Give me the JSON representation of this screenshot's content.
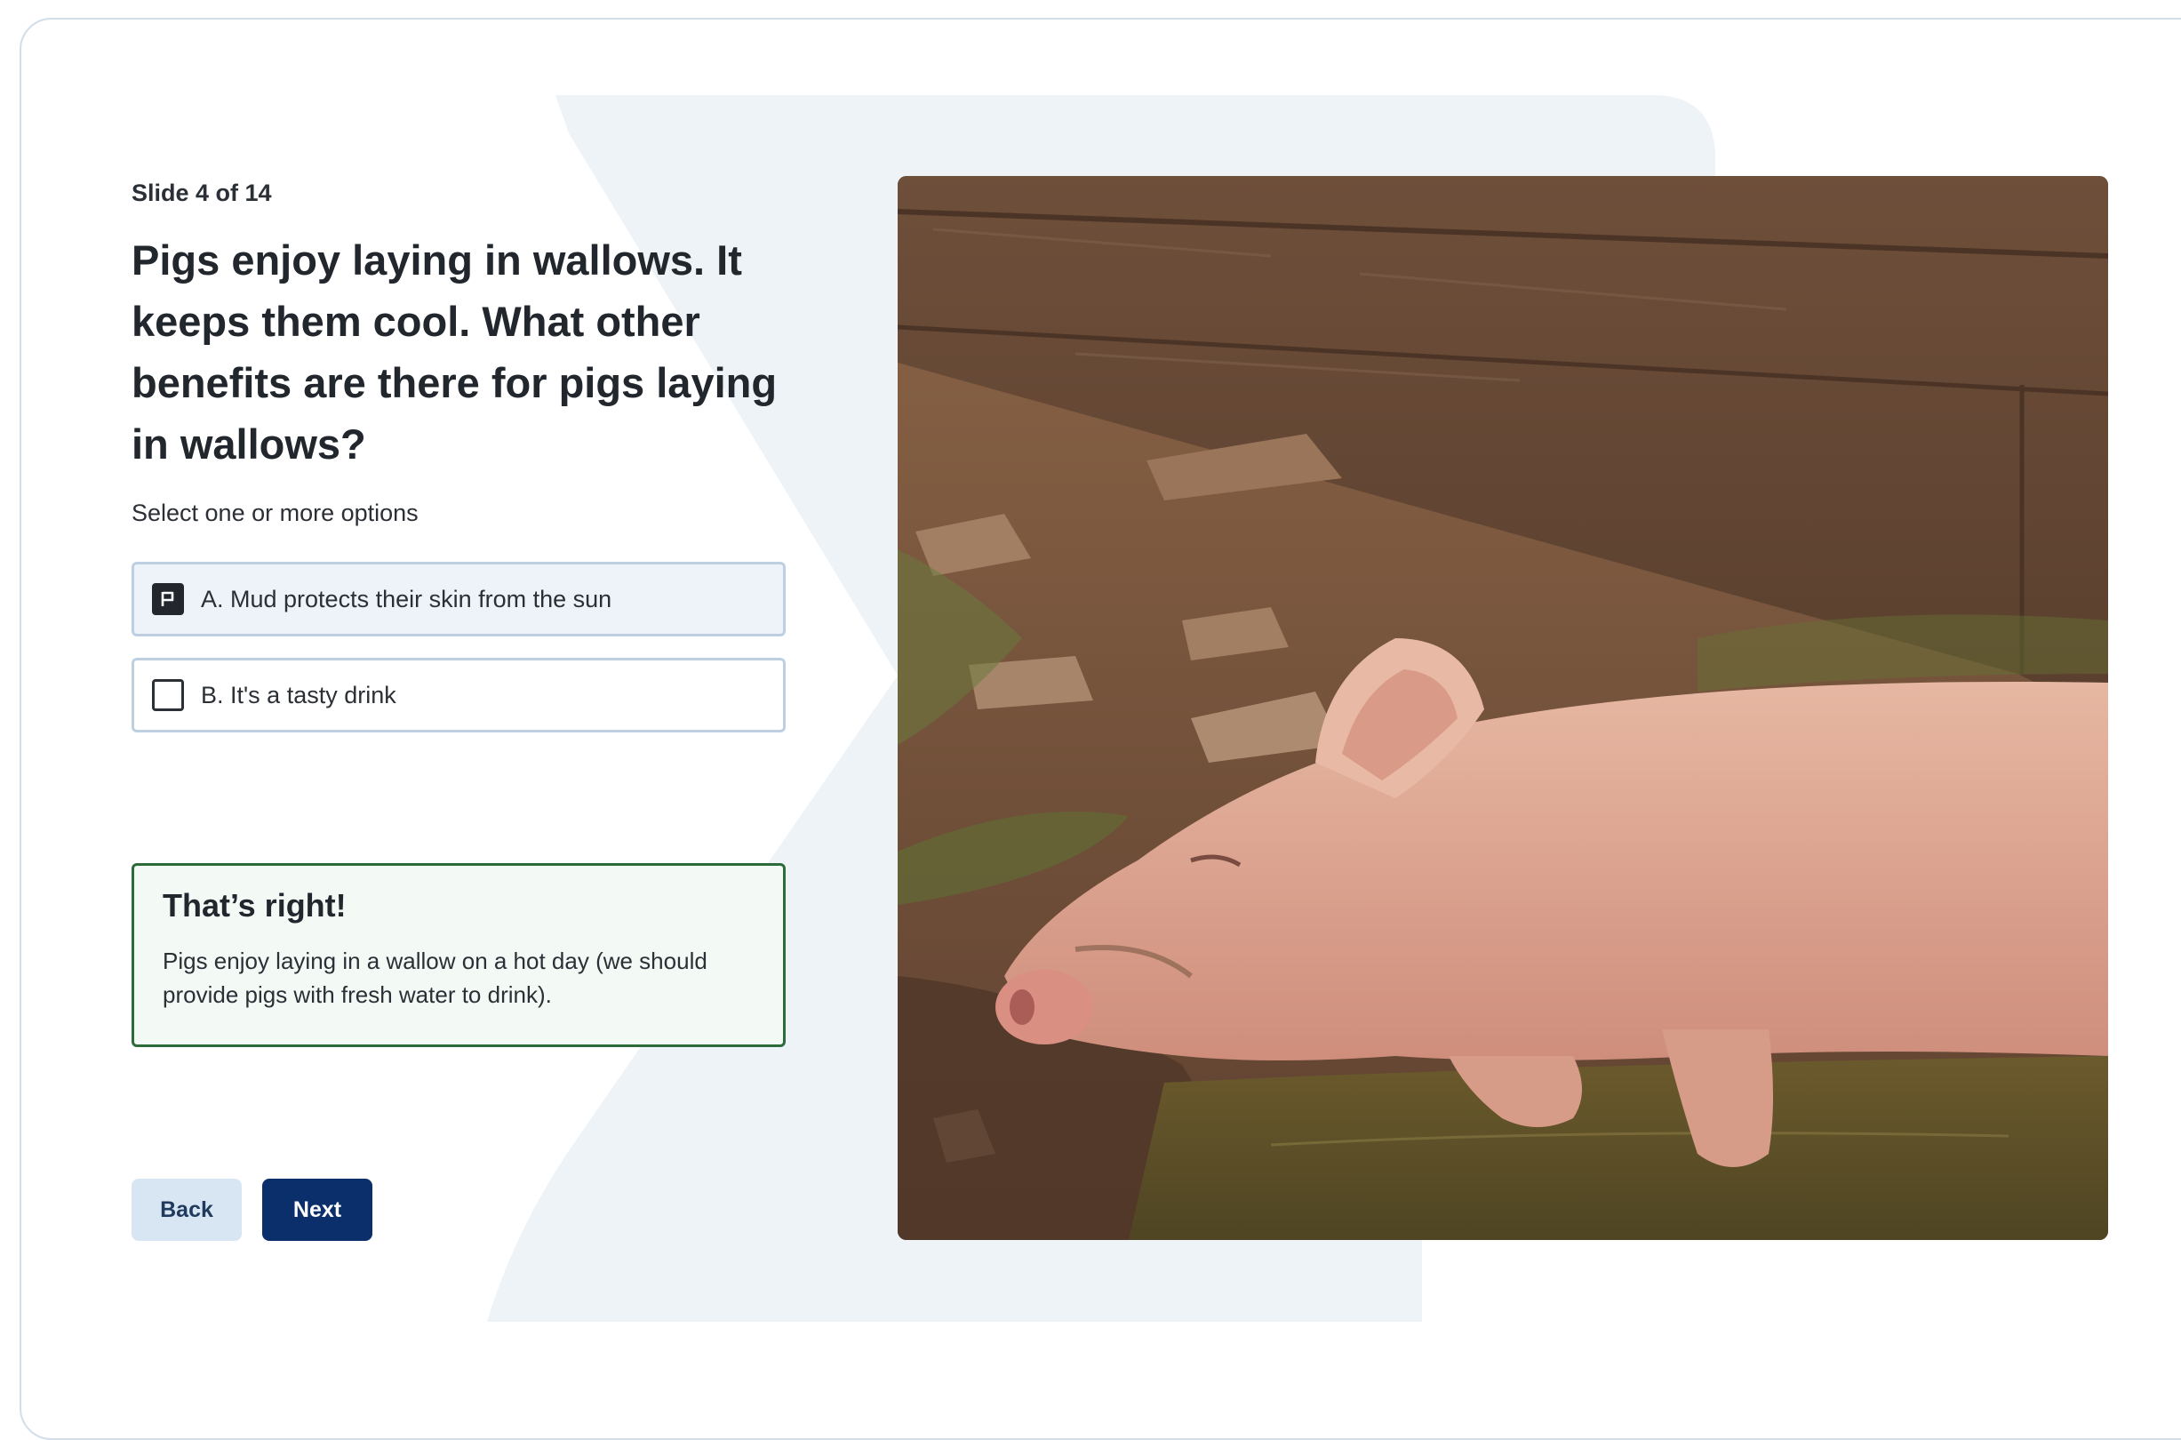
{
  "slide": {
    "counter": "Slide 4 of 14",
    "question": "Pigs enjoy laying in wallows. It keeps them cool. What other benefits are there for pigs laying in wallows?",
    "instruction": "Select one or more options"
  },
  "options": [
    {
      "label": "A. Mud protects their skin from the sun",
      "checked": true
    },
    {
      "label": "B. It's a tasty drink",
      "checked": false
    }
  ],
  "feedback": {
    "title": "That’s right!",
    "body": "Pigs enjoy laying in a wallow on a hot day (we should provide pigs with fresh water to drink)."
  },
  "buttons": {
    "back": "Back",
    "next": "Next"
  },
  "image": {
    "subject": "pig lying in a muddy wallow"
  },
  "colors": {
    "primary": "#0b2f6b",
    "secondary": "#d8e6f4",
    "success_border": "#2e6b3a",
    "background_shape": "#eef3f8"
  }
}
